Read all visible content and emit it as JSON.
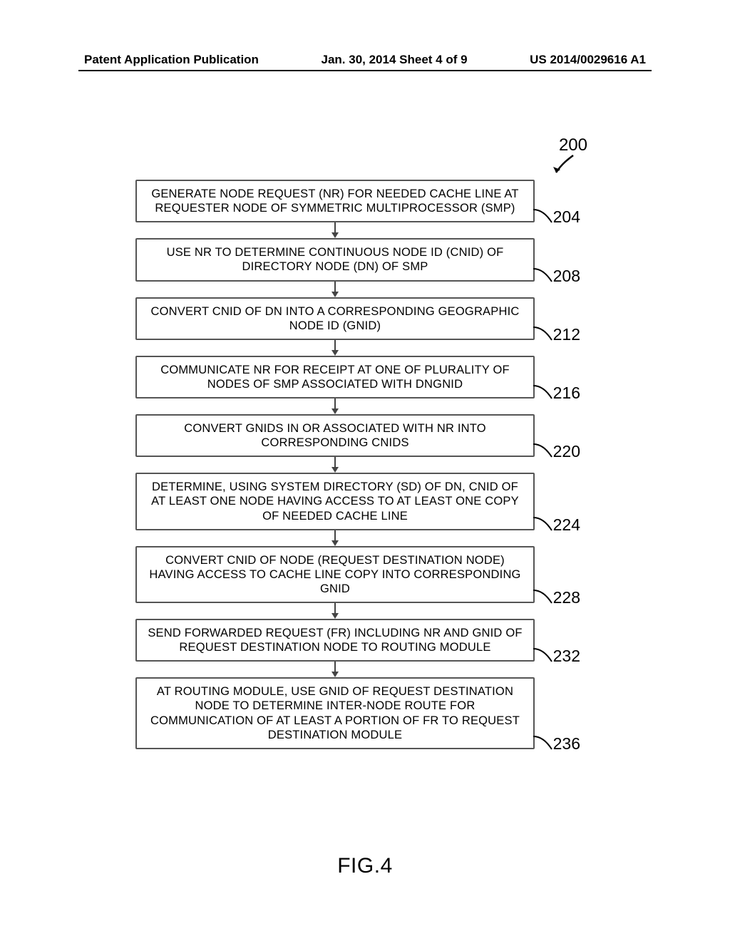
{
  "header": {
    "left": "Patent Application Publication",
    "center": "Jan. 30, 2014  Sheet 4 of 9",
    "right": "US 2014/0029616 A1"
  },
  "figure": {
    "ref_main": "200",
    "caption": "FIG.4",
    "steps": [
      {
        "ref": "204",
        "text": "GENERATE NODE REQUEST (NR) FOR NEEDED CACHE LINE AT REQUESTER NODE OF SYMMETRIC MULTIPROCESSOR (SMP)"
      },
      {
        "ref": "208",
        "text": "USE NR TO DETERMINE CONTINUOUS NODE ID (CNID) OF DIRECTORY NODE (DN) OF SMP"
      },
      {
        "ref": "212",
        "text": "CONVERT CNID OF DN INTO A CORRESPONDING GEOGRAPHIC NODE ID (GNID)"
      },
      {
        "ref": "216",
        "text": "COMMUNICATE NR FOR RECEIPT AT ONE OF PLURALITY OF NODES OF SMP ASSOCIATED WITH DNGNID"
      },
      {
        "ref": "220",
        "text": "CONVERT GNIDS IN OR ASSOCIATED WITH NR INTO CORRESPONDING CNIDS"
      },
      {
        "ref": "224",
        "text": "DETERMINE, USING SYSTEM DIRECTORY (SD) OF DN, CNID OF AT LEAST ONE NODE HAVING ACCESS TO AT LEAST ONE COPY OF NEEDED CACHE LINE"
      },
      {
        "ref": "228",
        "text": "CONVERT CNID OF NODE (REQUEST DESTINATION NODE) HAVING ACCESS TO CACHE LINE COPY INTO CORRESPONDING GNID"
      },
      {
        "ref": "232",
        "text": "SEND FORWARDED REQUEST (FR) INCLUDING NR AND GNID OF REQUEST DESTINATION NODE TO ROUTING MODULE"
      },
      {
        "ref": "236",
        "text": "AT ROUTING MODULE, USE GNID OF REQUEST DESTINATION NODE TO DETERMINE INTER-NODE ROUTE FOR COMMUNICATION OF AT LEAST A PORTION OF FR TO REQUEST DESTINATION MODULE"
      }
    ]
  }
}
